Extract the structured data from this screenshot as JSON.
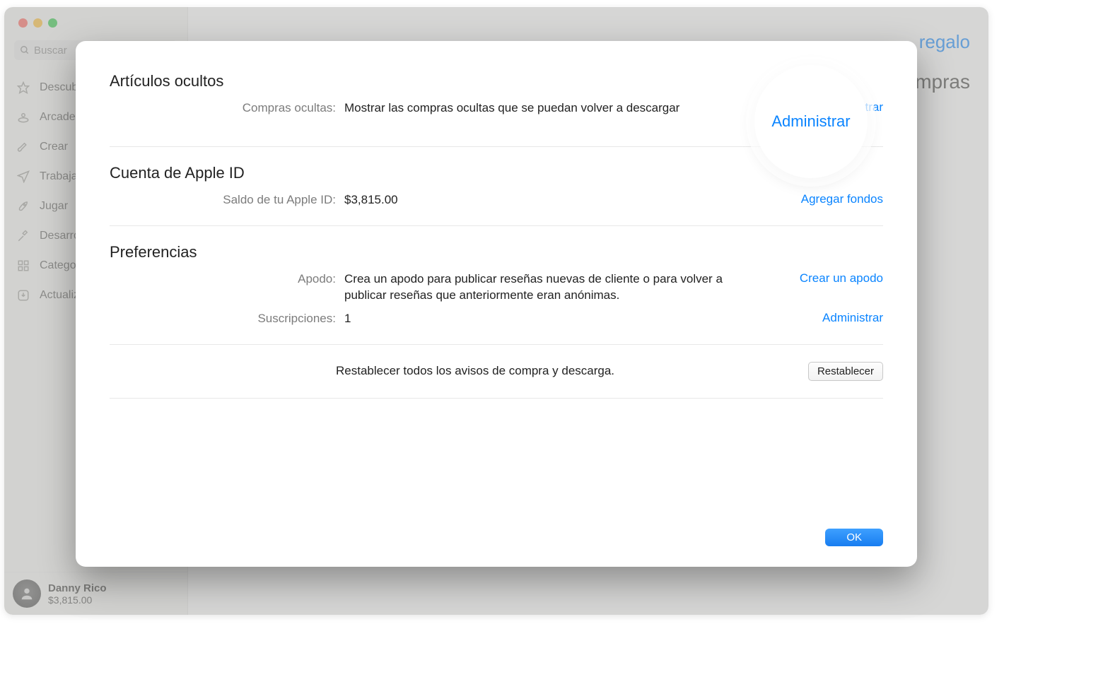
{
  "search": {
    "placeholder": "Buscar"
  },
  "sidebar": {
    "items": [
      {
        "label": "Descubrir"
      },
      {
        "label": "Arcade"
      },
      {
        "label": "Crear"
      },
      {
        "label": "Trabajar"
      },
      {
        "label": "Jugar"
      },
      {
        "label": "Desarrollar"
      },
      {
        "label": "Categorías"
      },
      {
        "label": "Actualizaciones"
      }
    ]
  },
  "user": {
    "name": "Danny Rico",
    "balance": "$3,815.00"
  },
  "bg": {
    "link": "regalo",
    "header": "…mpras"
  },
  "modal": {
    "sections": {
      "hidden": {
        "title": "Artículos ocultos",
        "rows": [
          {
            "label": "Compras ocultas:",
            "value": "Mostrar las compras ocultas que se puedan volver a descargar",
            "action": "Administrar"
          }
        ]
      },
      "account": {
        "title": "Cuenta de Apple ID",
        "rows": [
          {
            "label": "Saldo de tu Apple ID:",
            "value": "$3,815.00",
            "action": "Agregar fondos"
          }
        ]
      },
      "prefs": {
        "title": "Preferencias",
        "rows": [
          {
            "label": "Apodo:",
            "value": "Crea un apodo para publicar reseñas nuevas de cliente o para volver a publicar reseñas que anteriormente eran anónimas.",
            "action": "Crear un apodo"
          },
          {
            "label": "Suscripciones:",
            "value": "1",
            "action": "Administrar"
          }
        ]
      },
      "reset": {
        "text": "Restablecer todos los avisos de compra y descarga.",
        "button": "Restablecer"
      }
    },
    "ok": "OK"
  },
  "spotlight": "Administrar"
}
